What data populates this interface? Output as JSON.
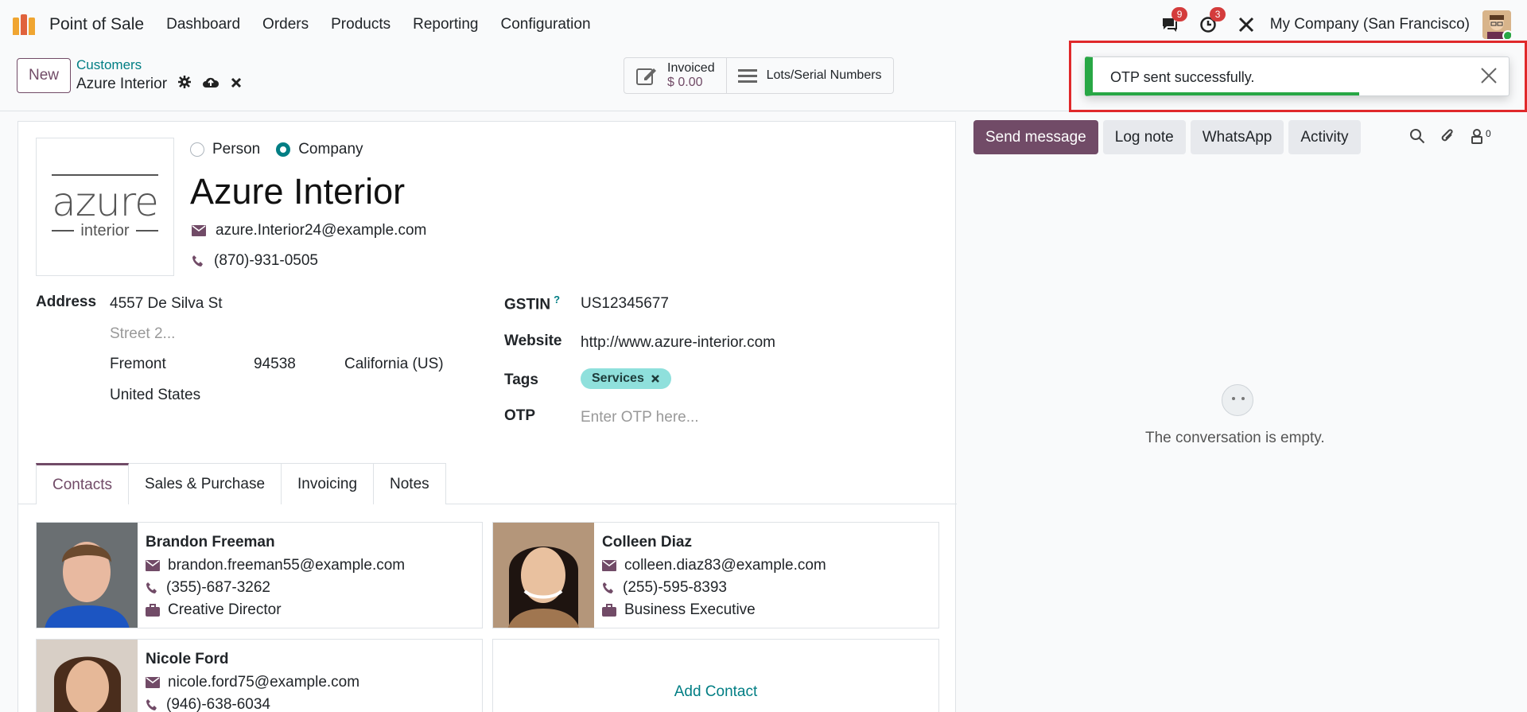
{
  "navbar": {
    "app_name": "Point of Sale",
    "menu": [
      "Dashboard",
      "Orders",
      "Products",
      "Reporting",
      "Configuration"
    ],
    "messages_count": "9",
    "activities_count": "3",
    "company": "My Company (San Francisco)"
  },
  "control": {
    "new_label": "New",
    "breadcrumb_parent": "Customers",
    "breadcrumb_current": "Azure Interior",
    "invoiced_label": "Invoiced",
    "invoiced_value": "$ 0.00",
    "lots_label": "Lots/Serial Numbers"
  },
  "toast": {
    "message": "OTP sent successfully.",
    "progress": 0.64
  },
  "partner": {
    "type_person": "Person",
    "type_company": "Company",
    "selected_type": "Company",
    "logo_main": "azure",
    "logo_sub": "interior",
    "name": "Azure Interior",
    "email": "azure.Interior24@example.com",
    "phone": "(870)-931-0505"
  },
  "address": {
    "label": "Address",
    "street": "4557 De Silva St",
    "street2_placeholder": "Street 2...",
    "city": "Fremont",
    "zip": "94538",
    "state": "California (US)",
    "country": "United States"
  },
  "fields": {
    "gstin_label": "GSTIN",
    "gstin_help": "?",
    "gstin_value": "US12345677",
    "website_label": "Website",
    "website_value": "http://www.azure-interior.com",
    "tags_label": "Tags",
    "tag": "Services",
    "otp_label": "OTP",
    "otp_placeholder": "Enter OTP here..."
  },
  "tabs": [
    "Contacts",
    "Sales & Purchase",
    "Invoicing",
    "Notes"
  ],
  "contacts": [
    {
      "name": "Brandon Freeman",
      "email": "brandon.freeman55@example.com",
      "phone": "(355)-687-3262",
      "job": "Creative Director"
    },
    {
      "name": "Colleen Diaz",
      "email": "colleen.diaz83@example.com",
      "phone": "(255)-595-8393",
      "job": "Business Executive"
    },
    {
      "name": "Nicole Ford",
      "email": "nicole.ford75@example.com",
      "phone": "(946)-638-6034",
      "job": ""
    }
  ],
  "add_contact": "Add Contact",
  "chatter": {
    "send_message": "Send message",
    "log_note": "Log note",
    "whatsapp": "WhatsApp",
    "activity": "Activity",
    "followers_count": "0",
    "empty_text": "The conversation is empty."
  },
  "colors": {
    "primary": "#714b67",
    "accent": "#017e84",
    "success": "#28a745",
    "badge": "#d43c3c",
    "tag": "#8fe0dc"
  }
}
